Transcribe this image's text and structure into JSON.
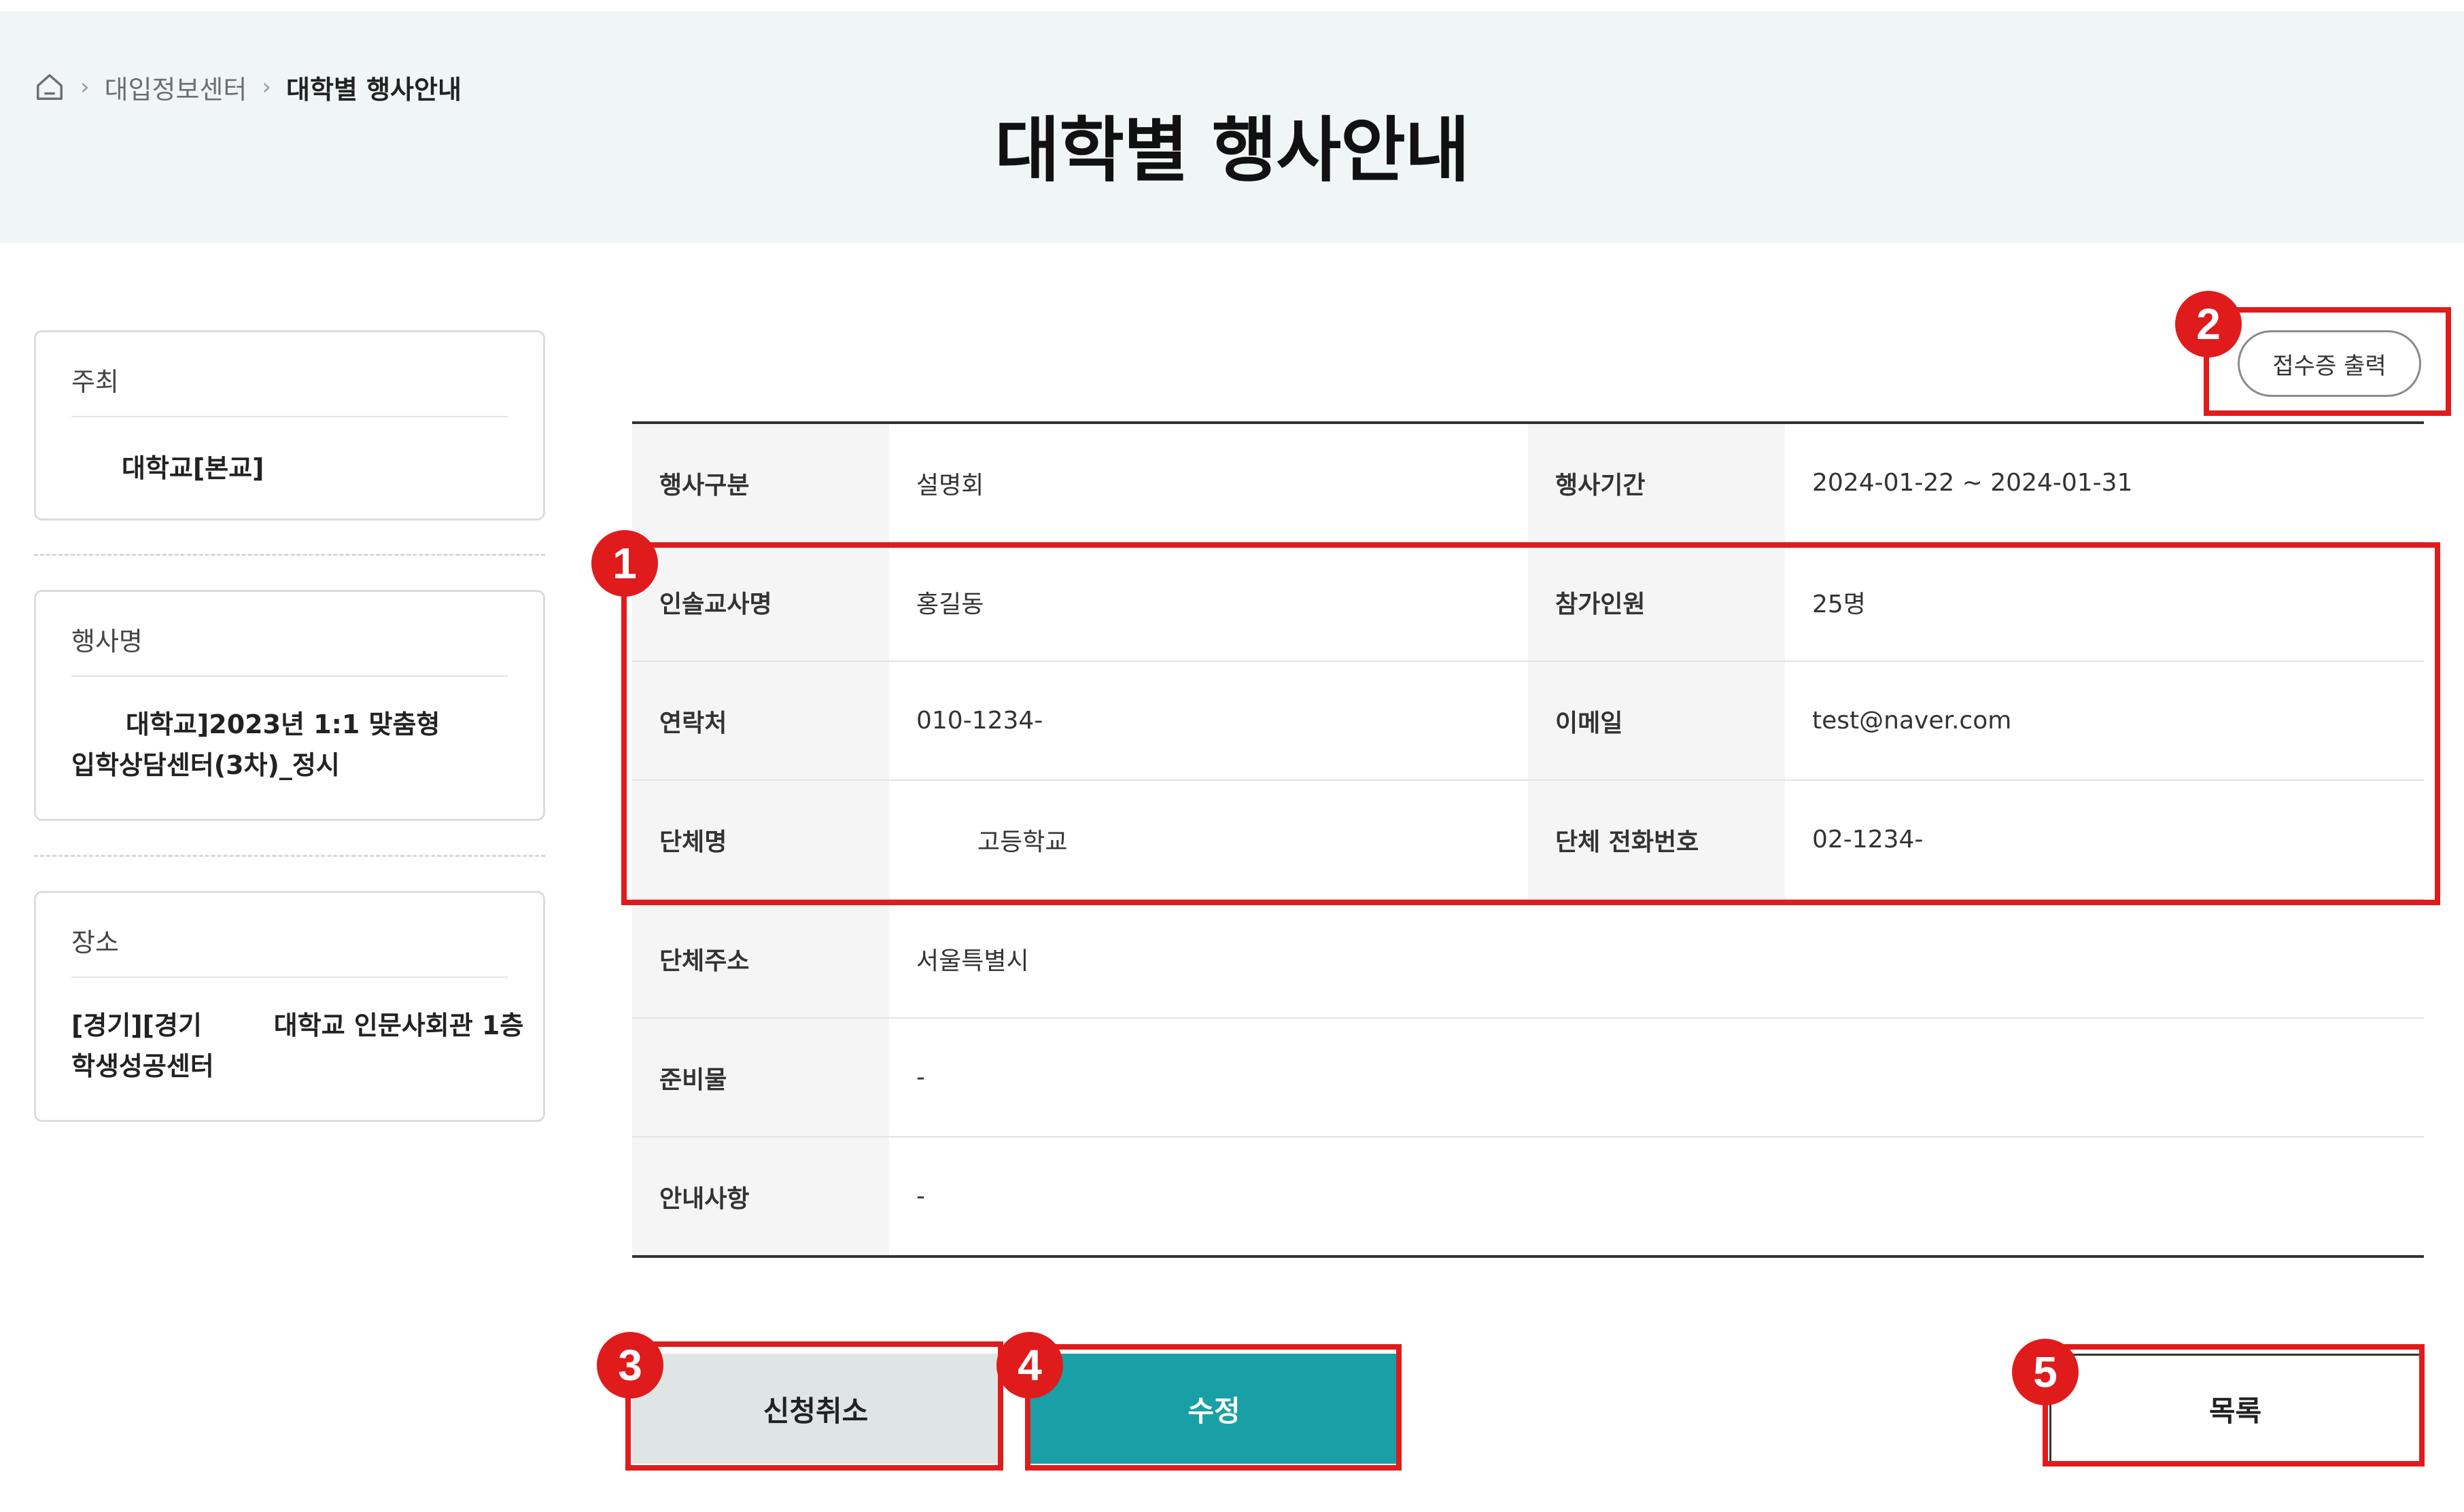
{
  "breadcrumb": {
    "home_icon": "home-icon",
    "separator": "›",
    "items": [
      "대입정보센터",
      "대학별 행사안내"
    ]
  },
  "page_title": "대학별 행사안내",
  "sidebar": {
    "host": {
      "label": "주최",
      "value": "대학교[본교]"
    },
    "event_name": {
      "label": "행사명",
      "value_line1": "대학교]2023년 1:1 맞춤형",
      "value_line2": "입학상담센터(3차)_정시"
    },
    "place": {
      "label": "장소",
      "value_line1": "[경기][경기        대학교 인문사회관 1층",
      "value_line2": "학생성공센터"
    }
  },
  "print_button": "접수증 출력",
  "details": {
    "event_type": {
      "label": "행사구분",
      "value": "설명회"
    },
    "event_period": {
      "label": "행사기간",
      "value": "2024-01-22 ~ 2024-01-31"
    },
    "teacher": {
      "label": "인솔교사명",
      "value": "홍길동"
    },
    "participants": {
      "label": "참가인원",
      "value": "25명"
    },
    "contact": {
      "label": "연락처",
      "value": "010-1234-"
    },
    "email": {
      "label": "이메일",
      "value": "test@naver.com"
    },
    "group_name": {
      "label": "단체명",
      "value": "고등학교"
    },
    "group_phone": {
      "label": "단체 전화번호",
      "value": "02-1234-"
    },
    "group_address": {
      "label": "단체주소",
      "value": "서울특별시"
    },
    "supplies": {
      "label": "준비물",
      "value": "-"
    },
    "notice": {
      "label": "안내사항",
      "value": "-"
    }
  },
  "buttons": {
    "cancel": "신청취소",
    "edit": "수정",
    "list": "목록"
  },
  "annotations": [
    "1",
    "2",
    "3",
    "4",
    "5"
  ],
  "colors": {
    "accent": "#19a0a6",
    "annotation": "#e01b1b",
    "hero_bg": "#f0f6f6"
  }
}
